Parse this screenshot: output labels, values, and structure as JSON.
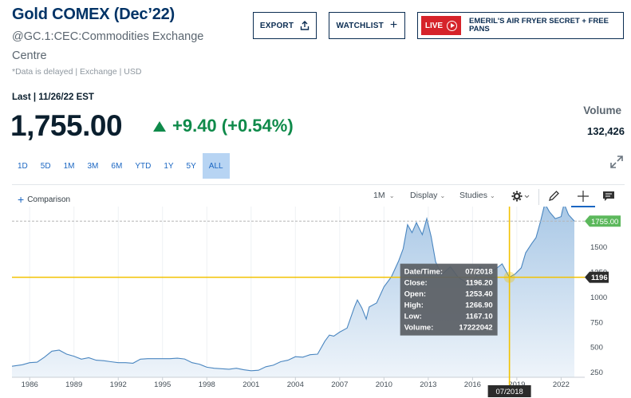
{
  "header": {
    "title": "Gold COMEX (Dec’22)",
    "symbol": "@GC.1:CEC:Commodities Exchange Centre",
    "delayed_note": "*Data is delayed | Exchange | USD"
  },
  "actions": {
    "export_label": "EXPORT",
    "watchlist_label": "WATCHLIST",
    "live_badge": "LIVE",
    "promo_text": "EMERIL'S AIR FRYER SECRET + FREE PANS"
  },
  "quote": {
    "last_label": "Last | 11/26/22 EST",
    "price": "1,755.00",
    "change": "+9.40 (+0.54%)",
    "volume_label": "Volume",
    "volume_value": "132,426",
    "colors": {
      "positive": "#0f8a4a"
    }
  },
  "ranges": [
    "1D",
    "5D",
    "1M",
    "3M",
    "6M",
    "YTD",
    "1Y",
    "5Y",
    "ALL"
  ],
  "active_range": "ALL",
  "toolbar": {
    "comparison_label": "Comparison",
    "interval_label": "1M",
    "display_label": "Display",
    "studies_label": "Studies"
  },
  "crosshair": {
    "x_label": "07/2018",
    "y_label": "1196",
    "tooltip": [
      {
        "k": "Date/Time:",
        "v": "07/2018"
      },
      {
        "k": "Close:",
        "v": "1196.20"
      },
      {
        "k": "Open:",
        "v": "1253.40"
      },
      {
        "k": "High:",
        "v": "1266.90"
      },
      {
        "k": "Low:",
        "v": "1167.10"
      },
      {
        "k": "Volume:",
        "v": "17222042"
      }
    ],
    "date_value": 2018.5,
    "price_value": 1196
  },
  "chart_data": {
    "type": "area",
    "x_ticks": [
      "1986",
      "1989",
      "1992",
      "1995",
      "1998",
      "2001",
      "2004",
      "2007",
      "2010",
      "2013",
      "2016",
      "2019",
      "2022"
    ],
    "y_ticks": [
      "250",
      "500",
      "750",
      "1000",
      "1250",
      "1500"
    ],
    "xlim": [
      1984.8,
      2023.6
    ],
    "ylim": [
      200,
      1900
    ],
    "last_value_label": "1755.00",
    "last_value": 1755,
    "colors": {
      "line": "#4a86c0",
      "fill_top": "#a9c8e6",
      "fill_bottom": "#eef4fa",
      "crosshair": "#f2c200",
      "last_badge": "#5cb85c"
    },
    "series": [
      {
        "x": [
          1984.8,
          1985.5,
          1986.0,
          1986.5,
          1987.0,
          1987.5,
          1988.0,
          1988.5,
          1989.0,
          1989.5,
          1990.0,
          1990.5,
          1991.0,
          1991.5,
          1992.0,
          1992.5,
          1993.0,
          1993.5,
          1994.0,
          1994.5,
          1995.0,
          1995.5,
          1996.0,
          1996.5,
          1997.0,
          1997.5,
          1998.0,
          1998.5,
          1999.0,
          1999.5,
          2000.0,
          2000.5,
          2001.0,
          2001.5,
          2002.0,
          2002.5,
          2003.0,
          2003.5,
          2004.0,
          2004.5,
          2005.0,
          2005.5,
          2006.0,
          2006.3,
          2006.6,
          2007.0,
          2007.5,
          2008.0,
          2008.2,
          2008.5,
          2008.8,
          2009.0,
          2009.5,
          2010.0,
          2010.5,
          2011.0,
          2011.3,
          2011.6,
          2011.9,
          2012.2,
          2012.6,
          2012.9,
          2013.2,
          2013.5,
          2013.9,
          2014.5,
          2015.0,
          2015.5,
          2015.9,
          2016.5,
          2017.0,
          2017.5,
          2018.0,
          2018.5,
          2018.9,
          2019.3,
          2019.6,
          2020.0,
          2020.3,
          2020.6,
          2020.9,
          2021.2,
          2021.6,
          2022.0,
          2022.2,
          2022.5,
          2022.9
        ],
        "y": [
          310,
          325,
          345,
          350,
          400,
          460,
          470,
          430,
          410,
          380,
          395,
          370,
          365,
          355,
          345,
          345,
          340,
          380,
          385,
          385,
          385,
          385,
          390,
          382,
          345,
          330,
          300,
          290,
          285,
          280,
          290,
          275,
          265,
          270,
          305,
          320,
          355,
          370,
          405,
          400,
          425,
          430,
          560,
          620,
          610,
          650,
          690,
          900,
          970,
          890,
          780,
          900,
          940,
          1100,
          1200,
          1360,
          1480,
          1720,
          1640,
          1740,
          1620,
          1780,
          1600,
          1350,
          1220,
          1300,
          1200,
          1150,
          1080,
          1300,
          1250,
          1270,
          1330,
          1196,
          1230,
          1290,
          1440,
          1530,
          1590,
          1750,
          1930,
          1850,
          1780,
          1800,
          1930,
          1820,
          1755
        ]
      }
    ]
  }
}
